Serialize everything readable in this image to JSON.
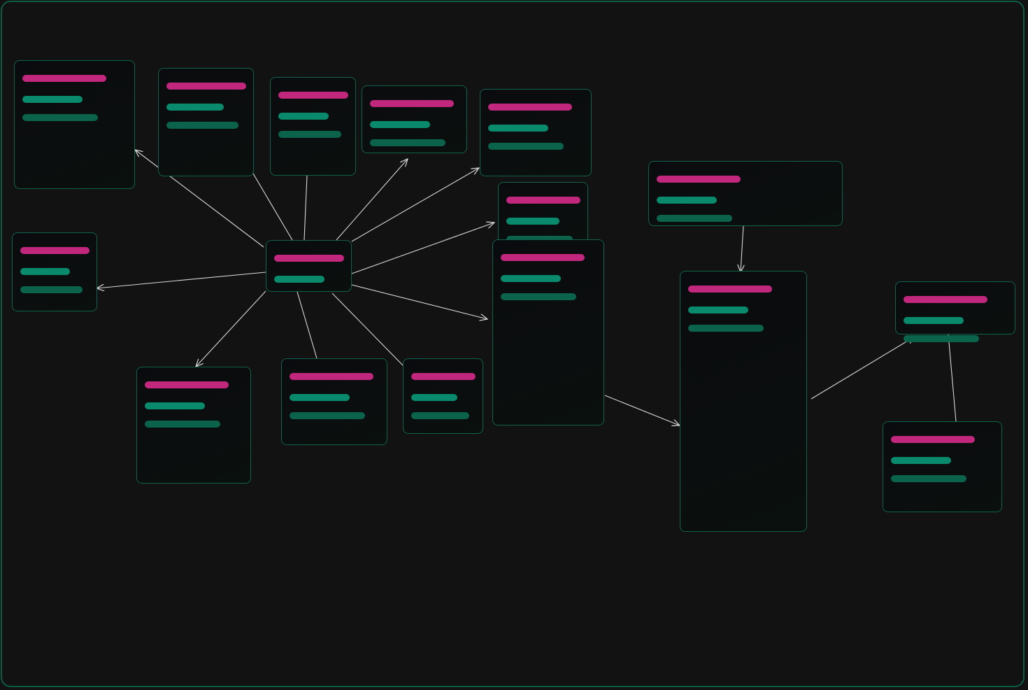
{
  "colors": {
    "background": "#121212",
    "frame_border": "#0e5a45",
    "node_border": "#10634a",
    "title_bar": "#c2277e",
    "line_bar_1": "#0a8a6c",
    "line_bar_2": "#0b634c",
    "edge": "#d9d9d9"
  },
  "nodes": [
    {
      "id": "n-center",
      "bars": [
        100,
        72
      ]
    },
    {
      "id": "n-top-1",
      "bars": [
        120,
        86,
        108
      ]
    },
    {
      "id": "n-top-2",
      "bars": [
        114,
        82,
        103
      ]
    },
    {
      "id": "n-top-3",
      "bars": [
        100,
        72,
        90
      ]
    },
    {
      "id": "n-top-4",
      "bars": [
        120,
        86,
        108
      ]
    },
    {
      "id": "n-top-5",
      "bars": [
        120,
        86,
        108
      ]
    },
    {
      "id": "n-mid-small",
      "bars": [
        106,
        76,
        95
      ]
    },
    {
      "id": "n-left",
      "bars": [
        99,
        71,
        89
      ]
    },
    {
      "id": "n-bottom-1",
      "bars": [
        120,
        86,
        108
      ]
    },
    {
      "id": "n-bottom-2",
      "bars": [
        120,
        86,
        108
      ]
    },
    {
      "id": "n-bottom-3",
      "bars": [
        92,
        66,
        83
      ]
    },
    {
      "id": "n-tall-1",
      "bars": [
        120,
        86,
        108
      ]
    },
    {
      "id": "n-top-wide",
      "bars": [
        120,
        86,
        108
      ]
    },
    {
      "id": "n-tall-2",
      "bars": [
        120,
        86,
        108
      ]
    },
    {
      "id": "n-right-1",
      "bars": [
        120,
        86,
        108
      ]
    },
    {
      "id": "n-right-2",
      "bars": [
        120,
        86,
        108
      ]
    }
  ],
  "edges": [
    {
      "from": "n-center",
      "to": "n-top-1",
      "arrow": true
    },
    {
      "from": "n-center",
      "to": "n-top-2",
      "arrow": false
    },
    {
      "from": "n-center",
      "to": "n-top-3",
      "arrow": false
    },
    {
      "from": "n-center",
      "to": "n-top-4",
      "arrow": true
    },
    {
      "from": "n-center",
      "to": "n-top-5",
      "arrow": true
    },
    {
      "from": "n-center",
      "to": "n-mid-small",
      "arrow": true
    },
    {
      "from": "n-center",
      "to": "n-tall-1",
      "arrow": true
    },
    {
      "from": "n-center",
      "to": "n-left",
      "arrow": true
    },
    {
      "from": "n-center",
      "to": "n-bottom-1",
      "arrow": true
    },
    {
      "from": "n-center",
      "to": "n-bottom-2",
      "arrow": false
    },
    {
      "from": "n-center",
      "to": "n-bottom-3",
      "arrow": false
    },
    {
      "from": "n-tall-1",
      "to": "n-tall-2",
      "arrow": true
    },
    {
      "from": "n-top-wide",
      "to": "n-tall-2",
      "arrow": true
    },
    {
      "from": "n-tall-2",
      "to": "n-right-1",
      "arrow": true
    },
    {
      "from": "n-right-1",
      "to": "n-right-2",
      "arrow": false
    }
  ]
}
